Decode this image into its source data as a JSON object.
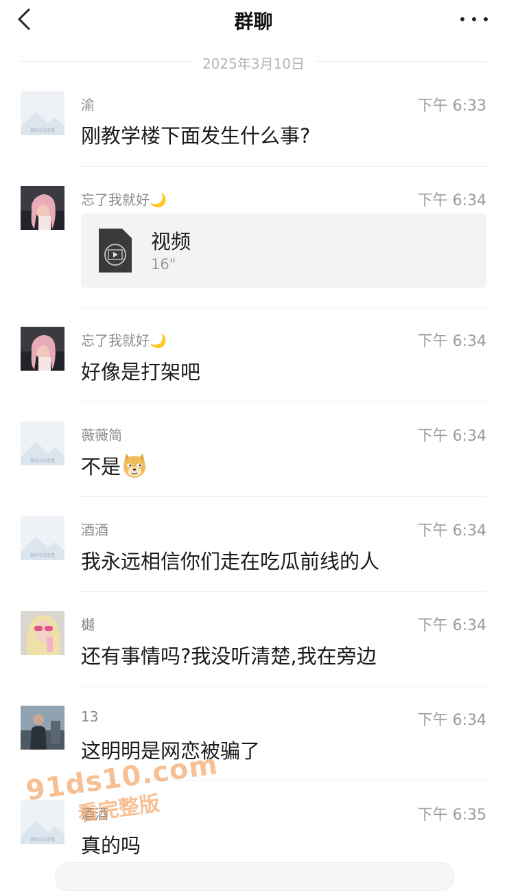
{
  "header": {
    "title": "群聊"
  },
  "date_label": "2025年3月10日",
  "placeholder_avatar_text": "暂时无法查看",
  "messages": [
    {
      "sender": "渝",
      "time": "下午 6:33",
      "text": "刚教学楼下面发生什么事?",
      "avatar": "placeholder"
    },
    {
      "sender": "忘了我就好🌙",
      "time": "下午 6:34",
      "type": "video",
      "video": {
        "title": "视频",
        "duration": "16\""
      },
      "avatar": "girl-photo"
    },
    {
      "sender": "忘了我就好🌙",
      "time": "下午 6:34",
      "text": "好像是打架吧",
      "avatar": "girl-photo"
    },
    {
      "sender": "薇薇简",
      "time": "下午 6:34",
      "text": "不是",
      "emoji": "doge-emoji",
      "avatar": "placeholder"
    },
    {
      "sender": "酒酒",
      "time": "下午 6:34",
      "text": "我永远相信你们走在吃瓜前线的人",
      "avatar": "placeholder"
    },
    {
      "sender": "樾",
      "time": "下午 6:34",
      "text": "还有事情吗?我没听清楚,我在旁边",
      "avatar": "blonde-photo"
    },
    {
      "sender": "13",
      "time": "下午 6:34",
      "text": "这明明是网恋被骗了",
      "avatar": "man-photo"
    },
    {
      "sender": "酒酒",
      "time": "下午 6:35",
      "text": "真的吗",
      "avatar": "placeholder"
    }
  ],
  "watermark": {
    "line1": "91ds10.com",
    "line2": "看完整版"
  },
  "icons": {
    "back": "chevron-left-icon",
    "more": "more-dots-icon",
    "video": "video-file-icon"
  }
}
